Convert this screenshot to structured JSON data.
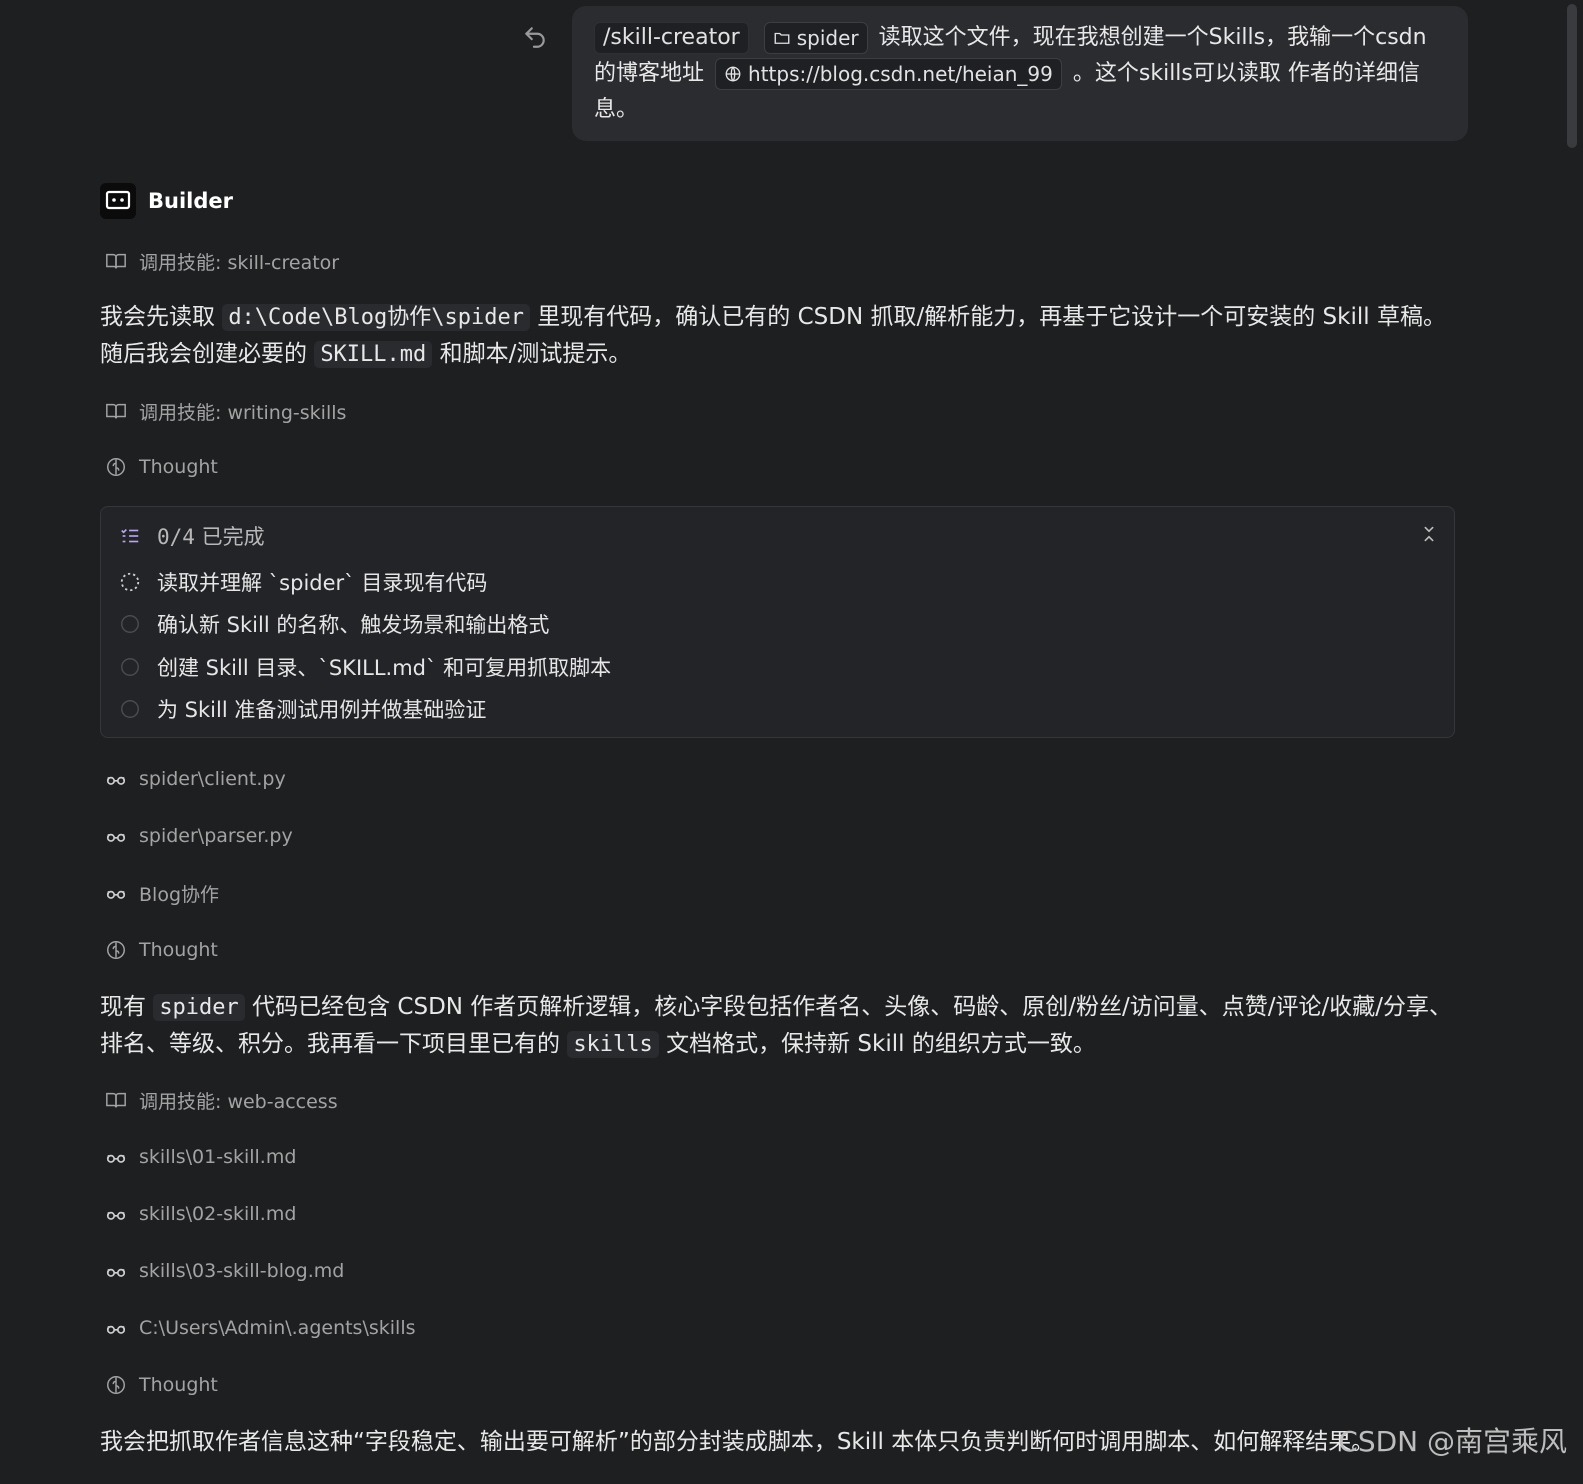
{
  "user_message": {
    "command": "/skill-creator",
    "folder_chip": "spider",
    "text1": "读取这个文件，现在我想创建一个Skills，我输一个csdn的博客地址",
    "url_chip": "https://blog.csdn.net/heian_99",
    "text2": "。这个skills可以读取 作者的详细信息。"
  },
  "assistant": {
    "name": "Builder",
    "skill_1": "调用技能: skill-creator",
    "para_1": {
      "a": "我会先读取",
      "code_1": "d:\\Code\\Blog协作\\spider",
      "b": "里现有代码，确认已有的 CSDN 抓取/解析能力，再基于它设计一个可安装的 Skill 草稿。随后我会创建必要的",
      "code_2": "SKILL.md",
      "c": "和脚本/测试提示。"
    },
    "skill_2": "调用技能: writing-skills",
    "thought_1": "Thought",
    "todo": {
      "count": "0/4",
      "status": "已完成",
      "items": [
        "读取并理解 `spider` 目录现有代码",
        "确认新 Skill 的名称、触发场景和输出格式",
        "创建 Skill 目录、`SKILL.md` 和可复用抓取脚本",
        "为 Skill 准备测试用例并做基础验证"
      ]
    },
    "reads_1": [
      "spider\\client.py",
      "spider\\parser.py",
      "Blog协作"
    ],
    "thought_2": "Thought",
    "para_2": {
      "a": "现有",
      "code_1": "spider",
      "b": "代码已经包含 CSDN 作者页解析逻辑，核心字段包括作者名、头像、码龄、原创/粉丝/访问量、点赞/评论/收藏/分享、排名、等级、积分。我再看一下项目里已有的",
      "code_2": "skills",
      "c": "文档格式，保持新 Skill 的组织方式一致。"
    },
    "skill_3": "调用技能: web-access",
    "reads_2": [
      "skills\\01-skill.md",
      "skills\\02-skill.md",
      "skills\\03-skill-blog.md",
      "C:\\Users\\Admin\\.agents\\skills"
    ],
    "thought_3": "Thought",
    "para_3": "我会把抓取作者信息这种“字段稳定、输出要可解析”的部分封装成脚本，Skill 本体只负责判断何时调用脚本、如何解释结果。"
  },
  "watermark": "CSDN @南宫乘风"
}
